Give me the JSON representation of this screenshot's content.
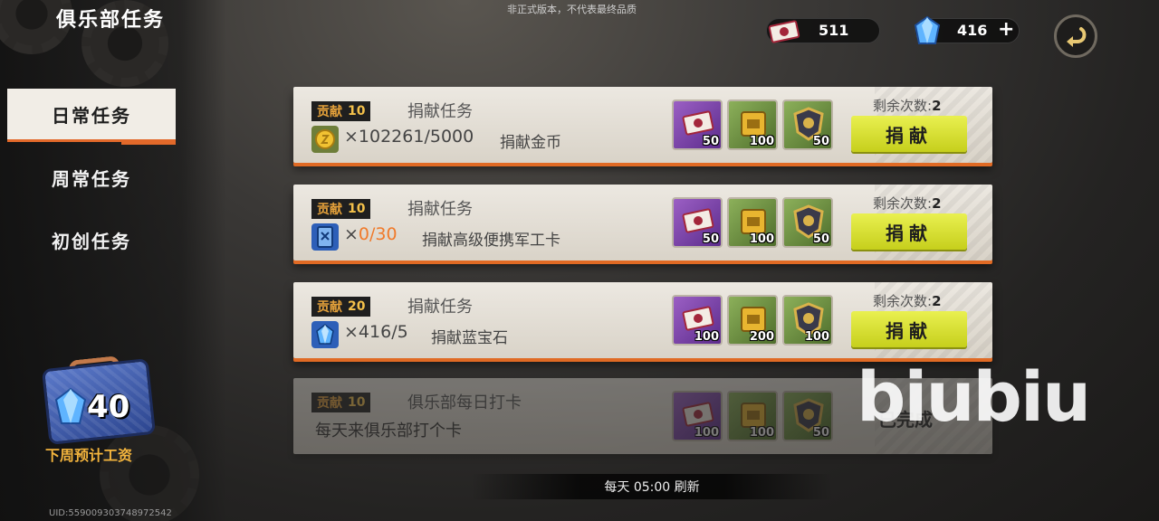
{
  "header": {
    "title": "俱乐部任务",
    "notice": "非正式版本，不代表最终品质"
  },
  "nav": {
    "items": [
      {
        "label": "日常任务",
        "active": true
      },
      {
        "label": "周常任务",
        "active": false
      },
      {
        "label": "初创任务",
        "active": false
      }
    ]
  },
  "currency": {
    "tickets": "511",
    "gems": "416",
    "add": "+"
  },
  "wage": {
    "amount": "40",
    "label": "下周预计工资"
  },
  "uid": "UID:559009303748972542",
  "tasks": [
    {
      "badge_label": "贡献",
      "badge_value": "10",
      "title": "捐献任务",
      "req_icon": "gold-coin-icon",
      "req_x": "×",
      "req_have": "102261",
      "req_need": "/5000",
      "req_name": "捐献金币",
      "rewards": [
        "50",
        "100",
        "50"
      ],
      "remain_label": "剩余次数:",
      "remain_value": "2",
      "button": "捐献"
    },
    {
      "badge_label": "贡献",
      "badge_value": "10",
      "title": "捐献任务",
      "req_icon": "military-card-icon",
      "req_x": "×",
      "req_have": "0/30",
      "req_need": "",
      "req_name": "捐献高级便携军工卡",
      "rewards": [
        "50",
        "100",
        "50"
      ],
      "remain_label": "剩余次数:",
      "remain_value": "2",
      "button": "捐献"
    },
    {
      "badge_label": "贡献",
      "badge_value": "20",
      "title": "捐献任务",
      "req_icon": "sapphire-icon",
      "req_x": "×",
      "req_have": "416",
      "req_need": "/5",
      "req_name": "捐献蓝宝石",
      "rewards": [
        "100",
        "200",
        "100"
      ],
      "remain_label": "剩余次数:",
      "remain_value": "2",
      "button": "捐献"
    },
    {
      "badge_label": "贡献",
      "badge_value": "10",
      "title": "俱乐部每日打卡",
      "desc": "每天来俱乐部打个卡",
      "rewards": [
        "100",
        "100",
        "50"
      ],
      "status": "已完成"
    }
  ],
  "watermark": "biubiu",
  "refresh": "每天 05:00 刷新",
  "colors": {
    "accent_orange": "#e06a24",
    "button_yellow": "#d8e036",
    "badge_gold": "#f4c14a",
    "wage_gold": "#f3b43d"
  }
}
